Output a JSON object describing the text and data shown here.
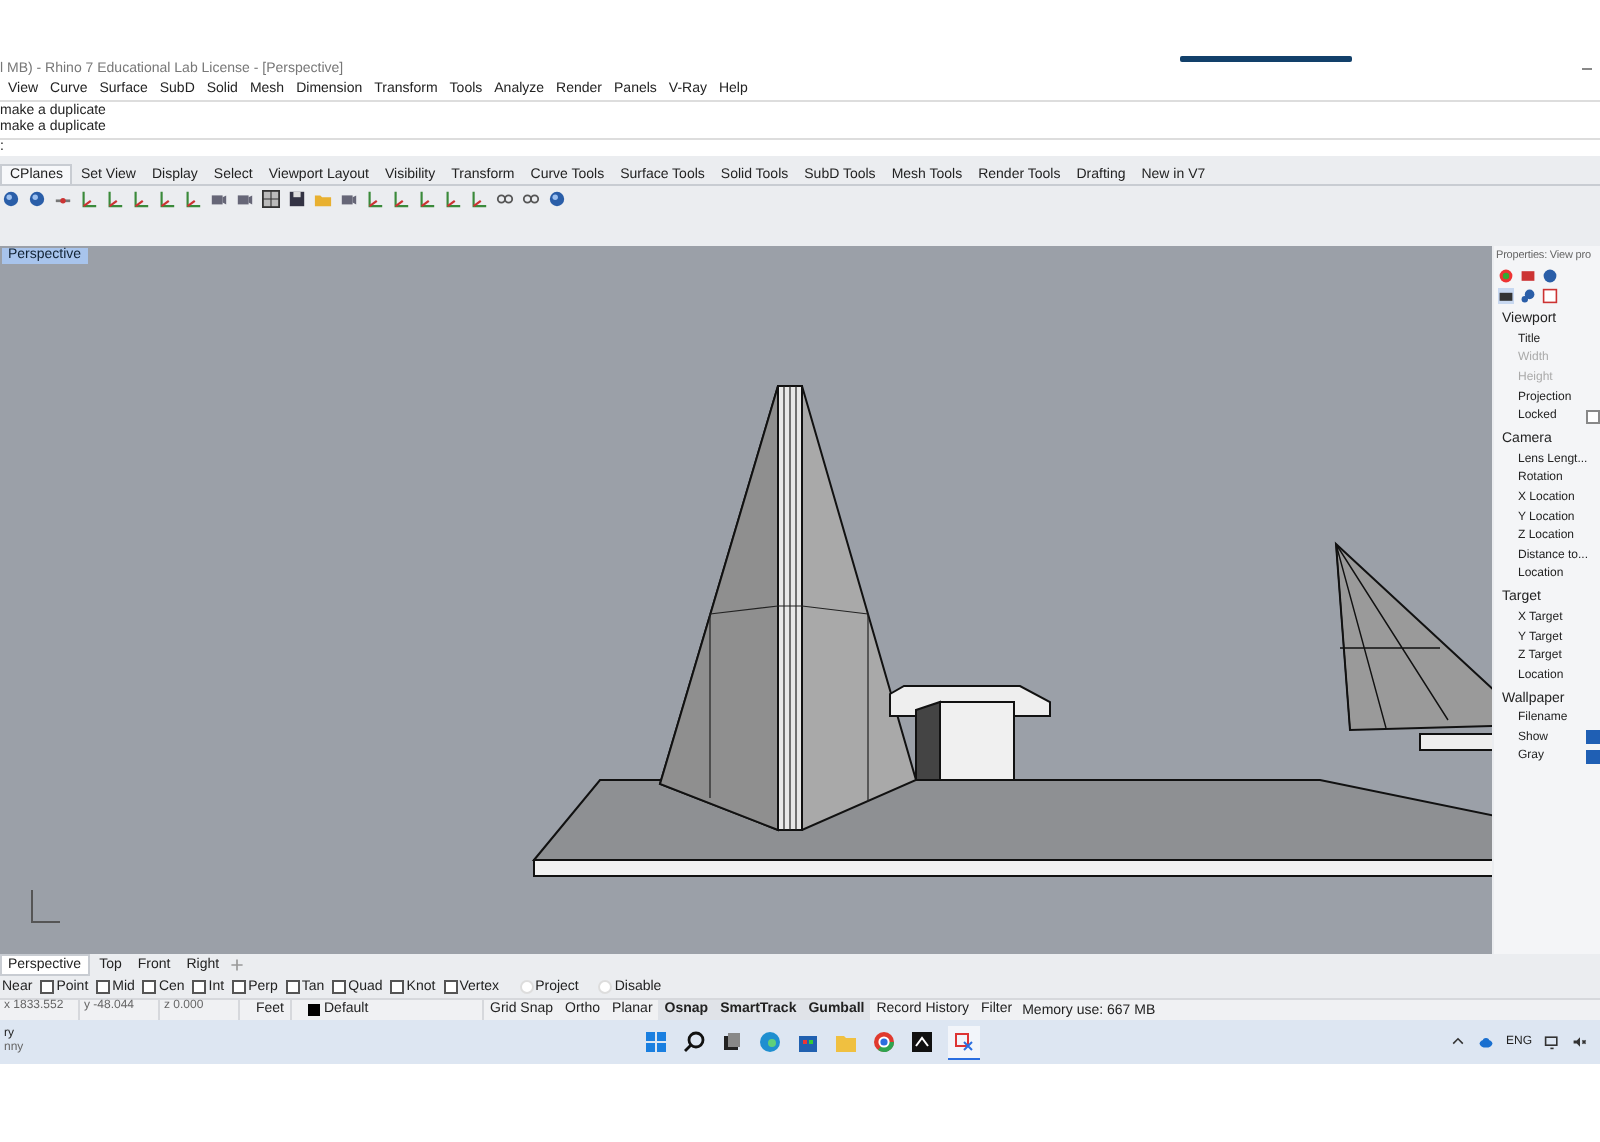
{
  "window": {
    "title": "l MB) - Rhino 7 Educational Lab License - [Perspective]"
  },
  "menu": [
    "View",
    "Curve",
    "Surface",
    "SubD",
    "Solid",
    "Mesh",
    "Dimension",
    "Transform",
    "Tools",
    "Analyze",
    "Render",
    "Panels",
    "V-Ray",
    "Help"
  ],
  "command_history": [
    "make a duplicate",
    "make a duplicate"
  ],
  "command_prompt": ":",
  "ribbon_tabs": [
    {
      "label": "CPlanes",
      "selected": true
    },
    {
      "label": "Set View",
      "selected": false
    },
    {
      "label": "Display",
      "selected": false
    },
    {
      "label": "Select",
      "selected": false
    },
    {
      "label": "Viewport Layout",
      "selected": false
    },
    {
      "label": "Visibility",
      "selected": false
    },
    {
      "label": "Transform",
      "selected": false
    },
    {
      "label": "Curve Tools",
      "selected": false
    },
    {
      "label": "Surface Tools",
      "selected": false
    },
    {
      "label": "Solid Tools",
      "selected": false
    },
    {
      "label": "SubD Tools",
      "selected": false
    },
    {
      "label": "Mesh Tools",
      "selected": false
    },
    {
      "label": "Render Tools",
      "selected": false
    },
    {
      "label": "Drafting",
      "selected": false
    },
    {
      "label": "New in V7",
      "selected": false
    }
  ],
  "viewport": {
    "title": "Perspective"
  },
  "properties": {
    "title": "Properties: View pro",
    "sections": [
      {
        "title": "Viewport",
        "rows": [
          {
            "label": "Title",
            "disabled": false
          },
          {
            "label": "Width",
            "disabled": true
          },
          {
            "label": "Height",
            "disabled": true
          },
          {
            "label": "Projection",
            "disabled": false
          },
          {
            "label": "Locked",
            "disabled": false,
            "checked": false
          }
        ]
      },
      {
        "title": "Camera",
        "rows": [
          {
            "label": "Lens Lengt...",
            "disabled": false
          },
          {
            "label": "Rotation",
            "disabled": false
          },
          {
            "label": "X Location",
            "disabled": false
          },
          {
            "label": "Y Location",
            "disabled": false
          },
          {
            "label": "Z Location",
            "disabled": false
          },
          {
            "label": "Distance to...",
            "disabled": false
          },
          {
            "label": "Location",
            "disabled": false
          }
        ]
      },
      {
        "title": "Target",
        "rows": [
          {
            "label": "X Target",
            "disabled": false
          },
          {
            "label": "Y Target",
            "disabled": false
          },
          {
            "label": "Z Target",
            "disabled": false
          },
          {
            "label": "Location",
            "disabled": false
          }
        ]
      },
      {
        "title": "Wallpaper",
        "rows": [
          {
            "label": "Filename",
            "disabled": false
          },
          {
            "label": "Show",
            "disabled": false,
            "checked": true
          },
          {
            "label": "Gray",
            "disabled": false,
            "checked": true
          }
        ]
      }
    ]
  },
  "viewport_tabs": [
    {
      "label": "Perspective",
      "selected": true
    },
    {
      "label": "Top",
      "selected": false
    },
    {
      "label": "Front",
      "selected": false
    },
    {
      "label": "Right",
      "selected": false
    }
  ],
  "osnap": {
    "lead": "Near",
    "snaps": [
      {
        "label": "Point",
        "checked": false
      },
      {
        "label": "Mid",
        "checked": false
      },
      {
        "label": "Cen",
        "checked": false
      },
      {
        "label": "Int",
        "checked": false
      },
      {
        "label": "Perp",
        "checked": false
      },
      {
        "label": "Tan",
        "checked": false
      },
      {
        "label": "Quad",
        "checked": false
      },
      {
        "label": "Knot",
        "checked": false
      },
      {
        "label": "Vertex",
        "checked": false
      }
    ],
    "options": [
      {
        "label": "Project",
        "selected": false
      },
      {
        "label": "Disable",
        "selected": false
      }
    ]
  },
  "status": {
    "x": "x 1833.552",
    "y": "y -48.044",
    "z": "z 0.000",
    "units": "Feet",
    "layer": {
      "name": "Default",
      "color": "#000000"
    },
    "toggles": [
      {
        "label": "Grid Snap",
        "on": false
      },
      {
        "label": "Ortho",
        "on": false
      },
      {
        "label": "Planar",
        "on": false
      },
      {
        "label": "Osnap",
        "on": true
      },
      {
        "label": "SmartTrack",
        "on": true
      },
      {
        "label": "Gumball",
        "on": true
      },
      {
        "label": "Record History",
        "on": false
      },
      {
        "label": "Filter",
        "on": false
      }
    ],
    "memory": "Memory use: 667 MB"
  },
  "taskbar": {
    "weather": [
      "ry",
      "nny"
    ],
    "language": "ENG"
  }
}
